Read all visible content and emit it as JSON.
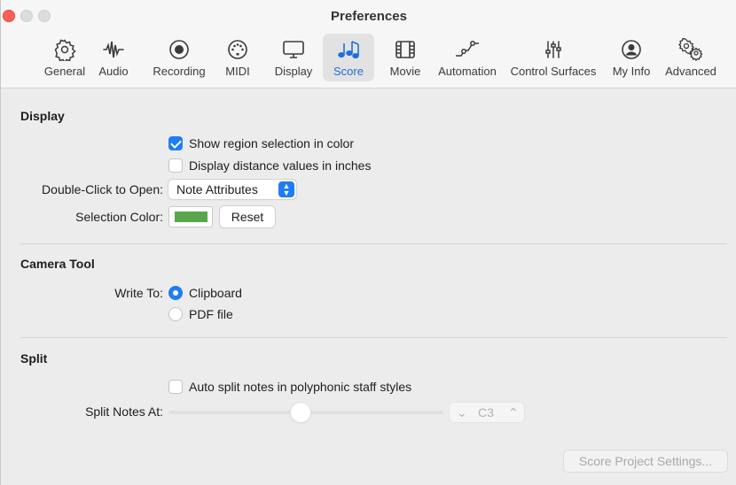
{
  "window": {
    "title": "Preferences"
  },
  "toolbar": {
    "items": [
      {
        "label": "General",
        "icon": "gear-icon"
      },
      {
        "label": "Audio",
        "icon": "waveform-icon"
      },
      {
        "label": "Recording",
        "icon": "record-icon"
      },
      {
        "label": "MIDI",
        "icon": "midi-port-icon"
      },
      {
        "label": "Display",
        "icon": "monitor-icon"
      },
      {
        "label": "Score",
        "icon": "music-notes-icon",
        "active": true
      },
      {
        "label": "Movie",
        "icon": "film-icon"
      },
      {
        "label": "Automation",
        "icon": "automation-curve-icon"
      },
      {
        "label": "Control Surfaces",
        "icon": "faders-icon"
      },
      {
        "label": "My Info",
        "icon": "person-icon"
      },
      {
        "label": "Advanced",
        "icon": "gears-icon"
      }
    ]
  },
  "display": {
    "title": "Display",
    "show_region_selection": {
      "label": "Show region selection in color",
      "checked": true
    },
    "distance_inches": {
      "label": "Display distance values in inches",
      "checked": false
    },
    "double_click": {
      "label": "Double-Click to Open:",
      "value": "Note Attributes"
    },
    "selection_color": {
      "label": "Selection Color:",
      "color": "#5aa64d",
      "reset_label": "Reset"
    }
  },
  "camera_tool": {
    "title": "Camera Tool",
    "write_to_label": "Write To:",
    "options": [
      {
        "label": "Clipboard",
        "selected": true
      },
      {
        "label": "PDF file",
        "selected": false
      }
    ]
  },
  "split": {
    "title": "Split",
    "auto_split": {
      "label": "Auto split notes in polyphonic staff styles",
      "checked": false
    },
    "split_at": {
      "label": "Split Notes At:",
      "value": "C3",
      "slider_fraction": 0.48
    }
  },
  "footer": {
    "project_settings_label": "Score Project Settings..."
  },
  "colors": {
    "accent": "#1f7cf5",
    "close": "#ff5f57",
    "selection_swatch": "#5aa64d"
  }
}
